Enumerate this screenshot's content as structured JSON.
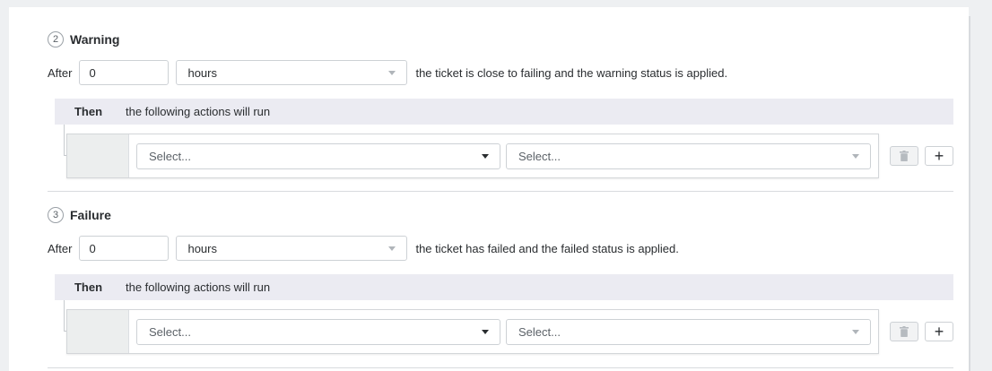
{
  "steps": [
    {
      "number": "2",
      "title": "Warning",
      "after_label": "After",
      "after_value": "0",
      "unit": "hours",
      "description": "the ticket is close to failing and the warning status is applied.",
      "then_label": "Then",
      "then_description": "the following actions will run",
      "action_select_placeholder": "Select...",
      "value_select_placeholder": "Select..."
    },
    {
      "number": "3",
      "title": "Failure",
      "after_label": "After",
      "after_value": "0",
      "unit": "hours",
      "description": "the ticket has failed and the failed status is applied.",
      "then_label": "Then",
      "then_description": "the following actions will run",
      "action_select_placeholder": "Select...",
      "value_select_placeholder": "Select..."
    }
  ],
  "icons": {
    "delete": "trash-icon",
    "add": "plus-icon",
    "add_glyph": "+"
  },
  "colors": {
    "then_bar": "#ebebf2",
    "gutter": "#eceeee",
    "border": "#cdd1d5"
  }
}
